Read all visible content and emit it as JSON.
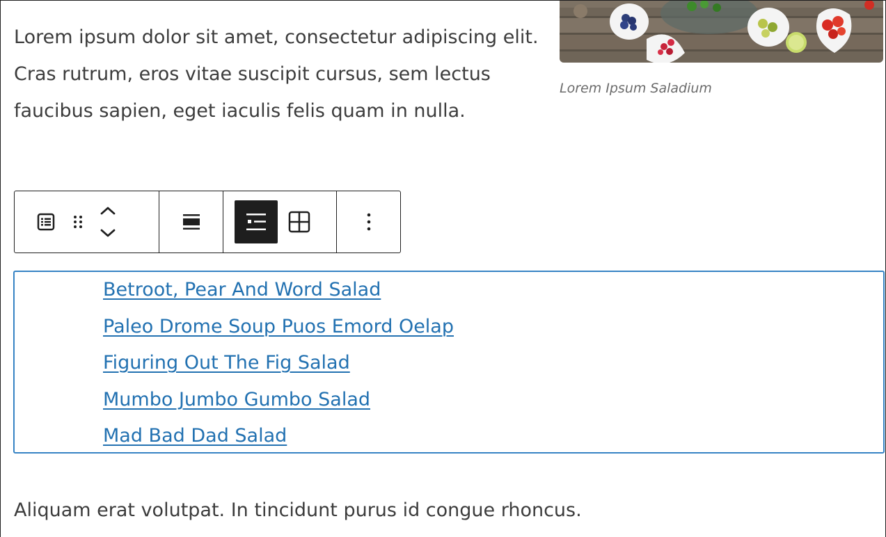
{
  "content": {
    "intro_paragraph": "Lorem ipsum dolor sit amet, consectetur adipiscing elit. Cras rutrum, eros vitae suscipit cursus, sem lectus faucibus sapien, eget iaculis felis quam in nulla.",
    "image_caption": "Lorem Ipsum Saladium",
    "outro_paragraph": "Aliquam erat volutpat. In tincidunt purus id congue rhoncus."
  },
  "toolbar": {
    "buttons": [
      {
        "icon": "list-view-icon"
      },
      {
        "icon": "drag-handle-icon"
      },
      {
        "icon": "move-up-down-icon"
      },
      {
        "icon": "align-wide-icon"
      },
      {
        "icon": "list-layout-icon",
        "pressed": true
      },
      {
        "icon": "grid-layout-icon"
      },
      {
        "icon": "more-options-icon"
      }
    ]
  },
  "latest_posts": {
    "items": [
      {
        "label": "Betroot, Pear And Word Salad"
      },
      {
        "label": "Paleo Drome Soup Puos Emord Oelap"
      },
      {
        "label": "Figuring Out The Fig Salad"
      },
      {
        "label": "Mumbo Jumbo Gumbo Salad"
      },
      {
        "label": "Mad Bad Dad Salad"
      }
    ]
  },
  "colors": {
    "link": "#2271b1",
    "selection_border": "#3582c4",
    "toolbar_pressed": "#1e1e1e",
    "text": "#3c3c3c"
  }
}
